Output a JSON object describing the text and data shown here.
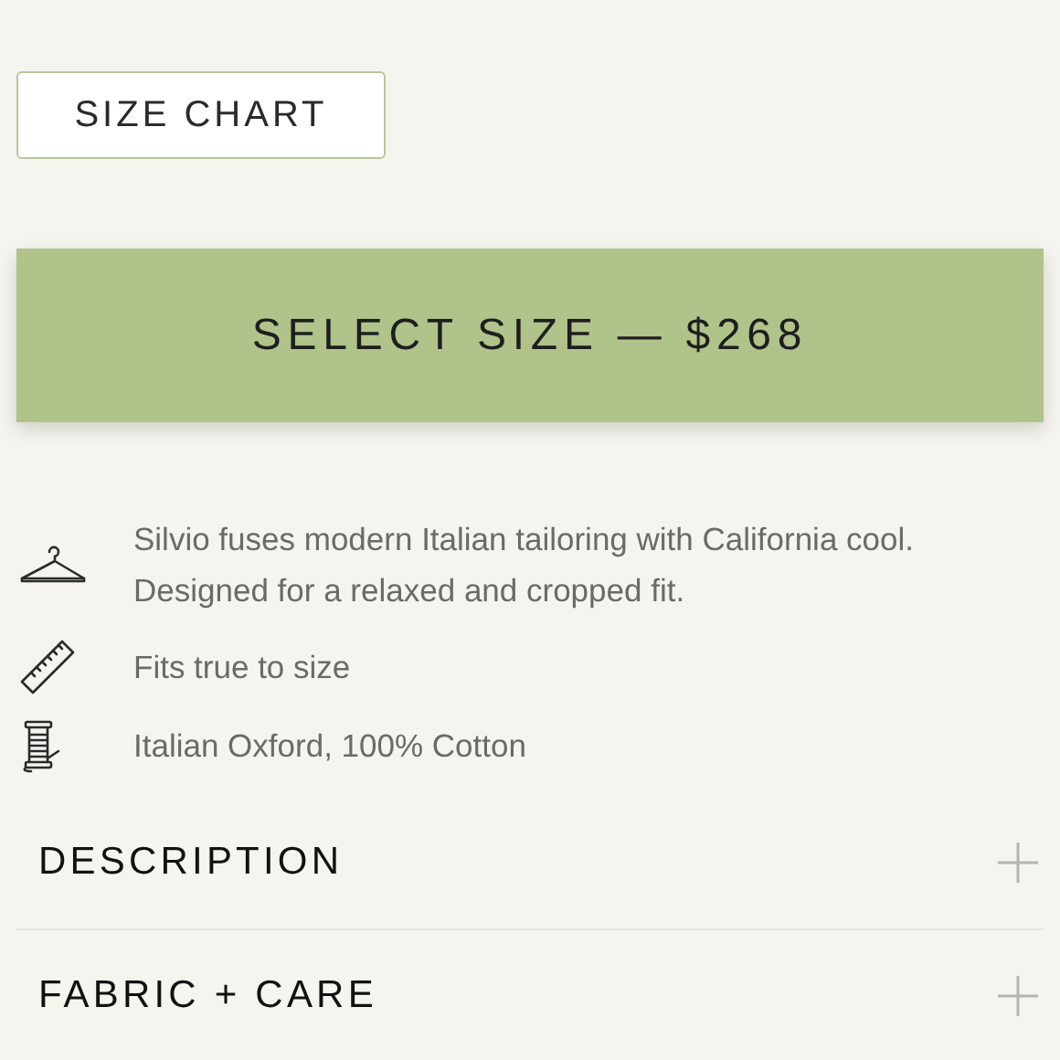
{
  "size_chart_button": "SIZE CHART",
  "select_button": "SELECT SIZE — $268",
  "features": [
    {
      "kind": "hanger",
      "text": "Silvio fuses modern Italian tailoring with California cool. Designed for a relaxed and cropped fit."
    },
    {
      "kind": "ruler",
      "text": "Fits true to size"
    },
    {
      "kind": "spool",
      "text": "Italian Oxford, 100% Cotton"
    }
  ],
  "accordion": [
    {
      "title": "DESCRIPTION",
      "expanded": false
    },
    {
      "title": "FABRIC + CARE",
      "expanded": false
    }
  ]
}
